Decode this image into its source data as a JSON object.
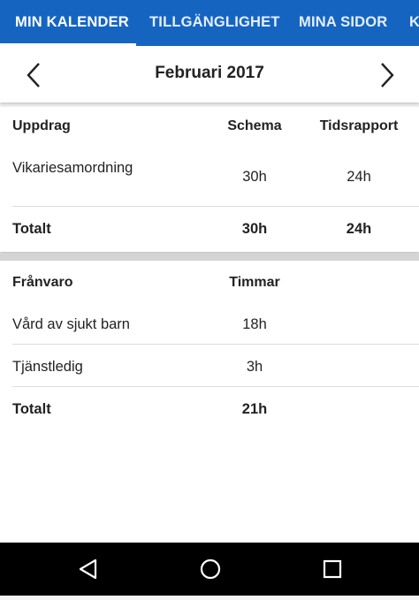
{
  "tabs": [
    {
      "label": "MIN KALENDER"
    },
    {
      "label": "TILLGÄNGLIGHET"
    },
    {
      "label": "MINA SIDOR"
    },
    {
      "label": "K"
    }
  ],
  "month": {
    "title": "Februari 2017"
  },
  "assignments": {
    "headers": {
      "col1": "Uppdrag",
      "col2": "Schema",
      "col3": "Tidsrapport"
    },
    "rows": [
      {
        "name": "Vikariesamordning",
        "schema": "30h",
        "report": "24h"
      }
    ],
    "total": {
      "label": "Totalt",
      "schema": "30h",
      "report": "24h"
    }
  },
  "absence": {
    "headers": {
      "col1": "Frånvaro",
      "col2": "Timmar"
    },
    "rows": [
      {
        "name": "Vård av sjukt barn",
        "hours": "18h"
      },
      {
        "name": "Tjänstledig",
        "hours": "3h"
      }
    ],
    "total": {
      "label": "Totalt",
      "hours": "21h"
    }
  },
  "colors": {
    "accent": "#1565c0",
    "navbar": "#000000"
  },
  "icons": {
    "prev": "chevron-left-icon",
    "next": "chevron-right-icon",
    "back": "back-triangle-icon",
    "home": "home-circle-icon",
    "recents": "recents-square-icon"
  }
}
